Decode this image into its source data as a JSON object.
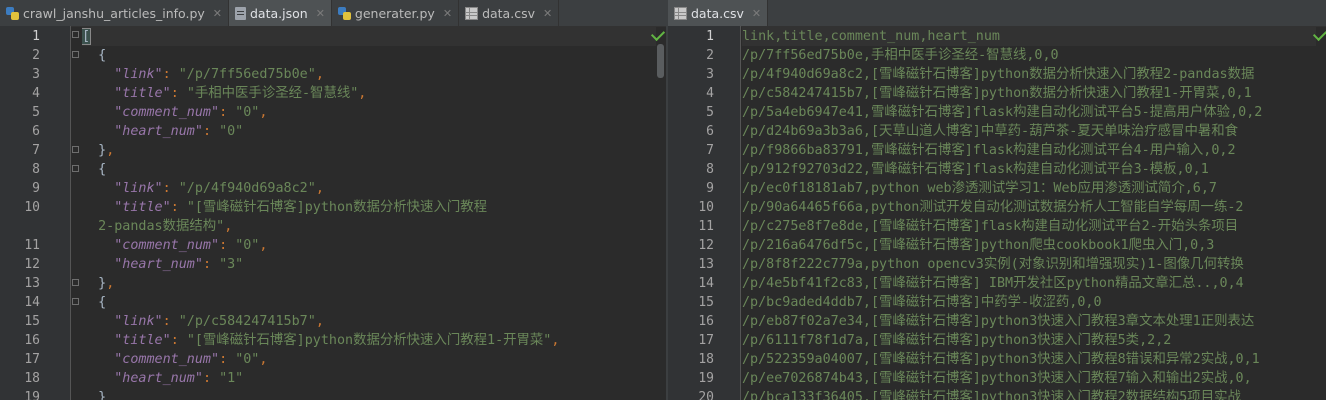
{
  "left": {
    "tabs": [
      {
        "label": "crawl_janshu_articles_info.py",
        "icon": "python-file-icon",
        "active": false
      },
      {
        "label": "data.json",
        "icon": "json-file-icon",
        "active": true
      },
      {
        "label": "generater.py",
        "icon": "python-file-icon",
        "active": false
      },
      {
        "label": "data.csv",
        "icon": "csv-file-icon",
        "active": false
      }
    ],
    "line_numbers": [
      "1",
      "2",
      "3",
      "4",
      "5",
      "6",
      "7",
      "8",
      "9",
      "10",
      "",
      "11",
      "12",
      "13",
      "14",
      "15",
      "16",
      "17",
      "18",
      "19"
    ],
    "json_text": {
      "link1": "\"/p/7ff56ed75b0e\"",
      "title1": "\"手相中医手诊圣经-智慧线\"",
      "comment1": "\"0\"",
      "heart1": "\"0\"",
      "link2": "\"/p/4f940d69a8c2\"",
      "title2a": "\"[雪峰磁针石博客]python数据分析快速入门教程",
      "title2b": "2-pandas数据结构\"",
      "comment2": "\"0\"",
      "heart2": "\"3\"",
      "link3": "\"/p/c584247415b7\"",
      "title3": "\"[雪峰磁针石博客]python数据分析快速入门教程1-开胃菜\"",
      "comment3": "\"0\"",
      "heart3": "\"1\"",
      "key_link": "\"link\"",
      "key_title": "\"title\"",
      "key_comment": "\"comment_num\"",
      "key_heart": "\"heart_num\""
    }
  },
  "right": {
    "tab": {
      "label": "data.csv",
      "icon": "csv-file-icon",
      "active": true
    },
    "line_numbers": [
      "1",
      "2",
      "3",
      "4",
      "5",
      "6",
      "7",
      "8",
      "9",
      "10",
      "11",
      "12",
      "13",
      "14",
      "15",
      "16",
      "17",
      "18",
      "19",
      "20"
    ],
    "csv_lines": [
      "link,title,comment_num,heart_num",
      "/p/7ff56ed75b0e,手相中医手诊圣经-智慧线,0,0",
      "/p/4f940d69a8c2,[雪峰磁针石博客]python数据分析快速入门教程2-pandas数据",
      "/p/c584247415b7,[雪峰磁针石博客]python数据分析快速入门教程1-开胃菜,0,1",
      "/p/5a4eb6947e41,雪峰磁针石博客]flask构建自动化测试平台5-提高用户体验,0,2",
      "/p/d24b69a3b3a6,[天草山道人博客]中草药-葫芦茶-夏天单味治疗感冒中暑和食",
      "/p/f9866ba83791,雪峰磁针石博客]flask构建自动化测试平台4-用户输入,0,2",
      "/p/912f92703d22,雪峰磁针石博客]flask构建自动化测试平台3-模板,0,1",
      "/p/ec0f18181ab7,python web渗透测试学习1：Web应用渗透测试简介,6,7",
      "/p/90a64465f66a,python测试开发自动化测试数据分析人工智能自学每周一练-2",
      "/p/c275e8f7e8de,[雪峰磁针石博客]flask构建自动化测试平台2-开始头条项目",
      "/p/216a6476df5c,[雪峰磁针石博客]python爬虫cookbook1爬虫入门,0,3",
      "/p/8f8f222c779a,python opencv3实例(对象识别和增强现实)1-图像几何转换",
      "/p/4e5bf41f2c83,[雪峰磁针石博客] IBM开发社区python精品文章汇总..,0,4",
      "/p/bc9aded4ddb7,[雪峰磁针石博客]中药学-收涩药,0,0",
      "/p/eb87f02a7e34,[雪峰磁针石博客]python3快速入门教程3章文本处理1正则表达",
      "/p/6111f78f1d7a,[雪峰磁针石博客]python3快速入门教程5类,2,2",
      "/p/522359a04007,[雪峰磁针石博客]python3快速入门教程8错误和异常2实战,0,1",
      "/p/ee7026874b43,[雪峰磁针石博客]python3快速入门教程7输入和输出2实战,0,",
      "/p/bca133f36405,[雪峰磁针石博客]python3快速入门教程2数据结构5项目实战"
    ]
  },
  "colors": {
    "background": "#2b2b2b",
    "json_key": "#9876aa",
    "json_string": "#6a8759",
    "punctuation": "#cc7832",
    "inspection_ok": "#62b543"
  }
}
